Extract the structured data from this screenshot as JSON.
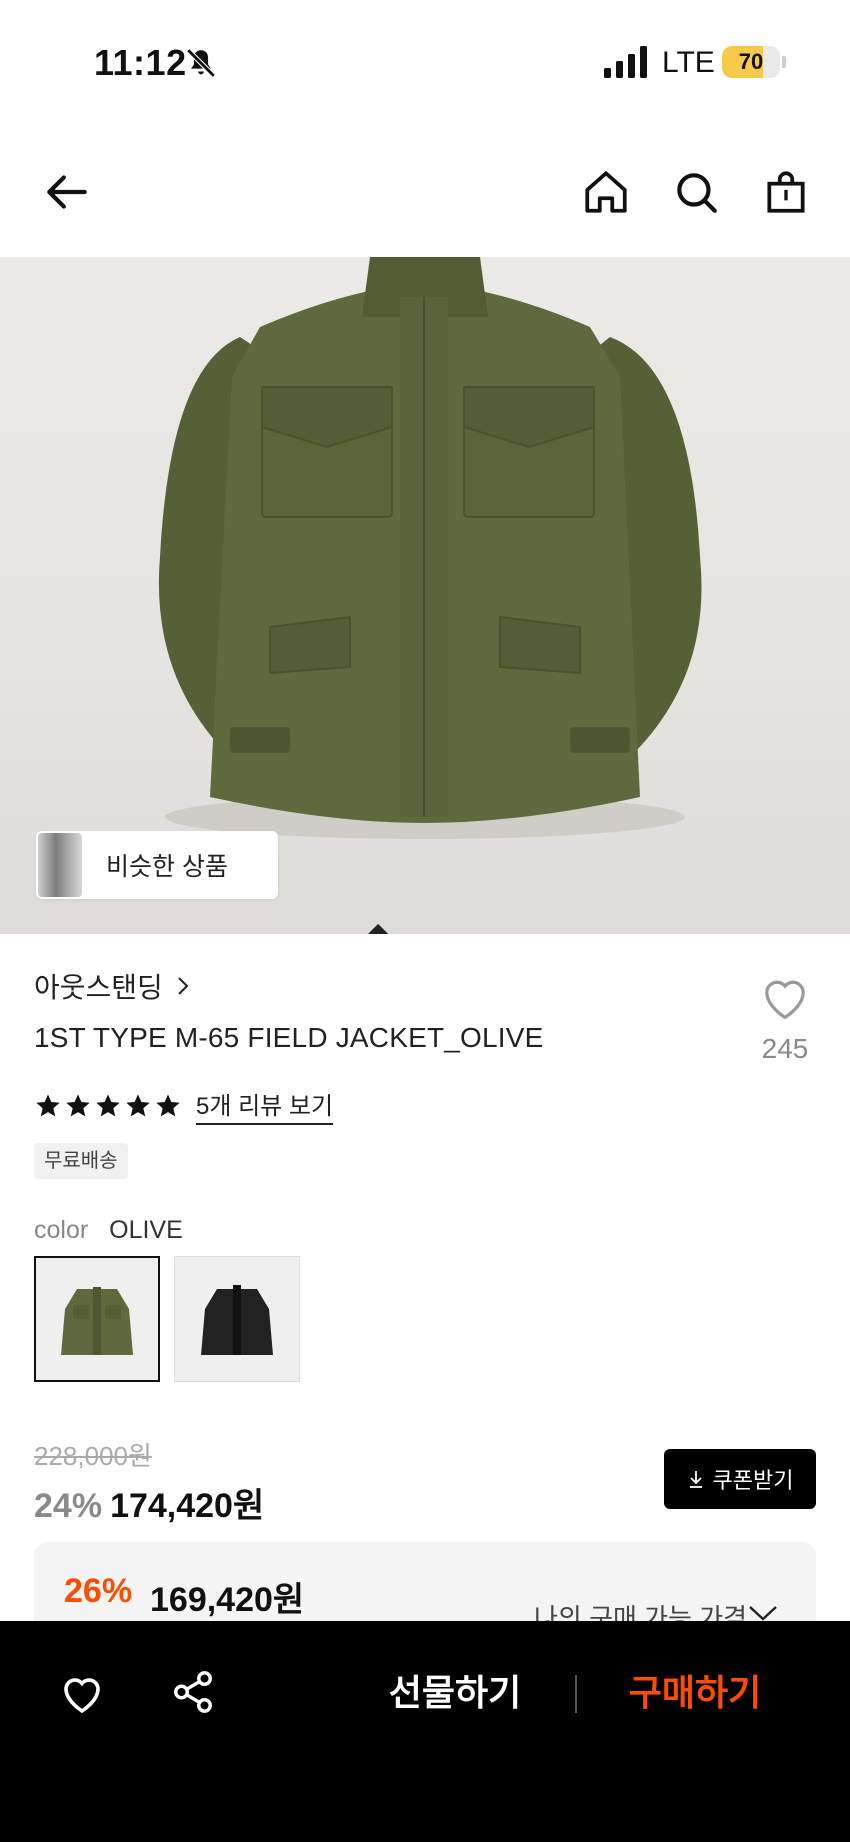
{
  "status_bar": {
    "time": "11:12",
    "network": "LTE",
    "battery": "70",
    "battery_level_percent": 70
  },
  "nav": {
    "icons": [
      "back-arrow-icon",
      "home-icon",
      "search-icon",
      "shopping-bag-icon"
    ]
  },
  "hero": {
    "similar_products_label": "비슷한 상품"
  },
  "product": {
    "brand": "아웃스탠딩",
    "title": "1ST TYPE M-65 FIELD JACKET_OLIVE",
    "like_count": "245",
    "rating_stars": 5,
    "review_link": "5개 리뷰 보기",
    "free_shipping_badge": "무료배송",
    "color_label": "color",
    "color_value": "OLIVE",
    "swatches": [
      "olive",
      "black"
    ]
  },
  "price": {
    "original": "228,000원",
    "discount": "24%",
    "sale": "174,420원",
    "coupon_button": "쿠폰받기",
    "my_discount": "26%",
    "my_price": "169,420원",
    "my_price_label": "나의 구매 가능 가격"
  },
  "bottom_bar": {
    "gift_label": "선물하기",
    "buy_label": "구매하기"
  },
  "colors": {
    "accent_orange": "#ff4d00",
    "olive": "#5a6339",
    "bottom_bar": "#000000"
  }
}
